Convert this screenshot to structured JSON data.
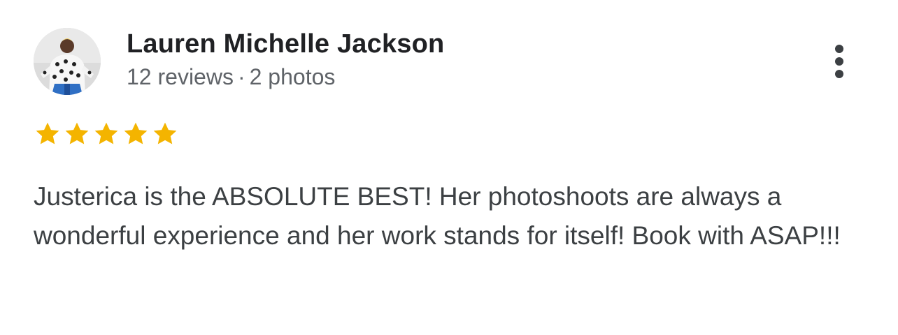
{
  "review": {
    "author": {
      "name": "Lauren Michelle Jackson",
      "reviews": "12 reviews",
      "separator": "·",
      "photos": "2 photos",
      "avatar_icon": "user-photo-avatar"
    },
    "rating": {
      "value": 5,
      "max": 5,
      "star_color": "#f4b400"
    },
    "text": "Justerica is the ABSOLUTE BEST! Her photoshoots are always a wonderful experience and her work stands for itself! Book with ASAP!!!",
    "more_icon": "more-vert-icon"
  }
}
